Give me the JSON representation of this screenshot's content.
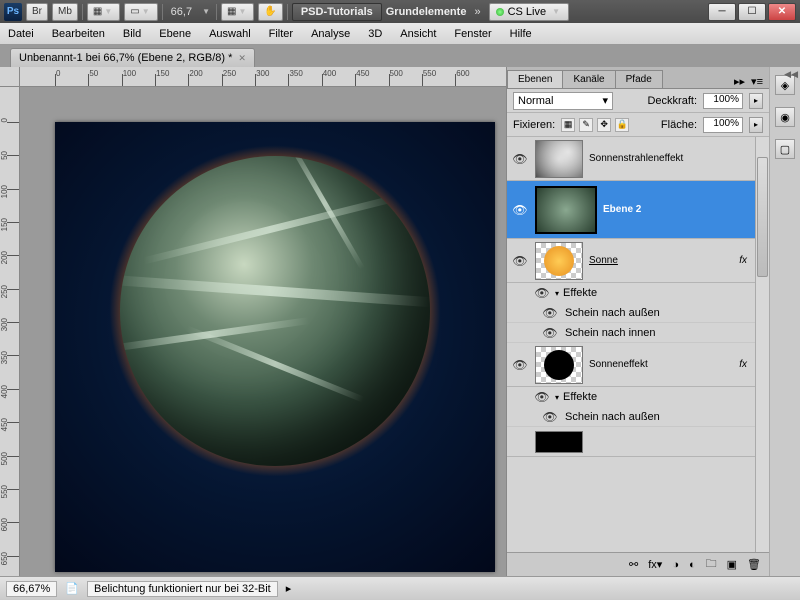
{
  "titlebar": {
    "br": "Br",
    "mb": "Mb",
    "zoom": "66,7",
    "psd_tutorials": "PSD-Tutorials",
    "grundelemente": "Grundelemente",
    "cs_live": "CS Live"
  },
  "menu": {
    "items": [
      "Datei",
      "Bearbeiten",
      "Bild",
      "Ebene",
      "Auswahl",
      "Filter",
      "Analyse",
      "3D",
      "Ansicht",
      "Fenster",
      "Hilfe"
    ]
  },
  "doc": {
    "tab": "Unbenannt-1 bei 66,7% (Ebene 2, RGB/8) *"
  },
  "panel": {
    "tabs": {
      "ebenen": "Ebenen",
      "kanaele": "Kanäle",
      "pfade": "Pfade"
    },
    "blend": {
      "mode": "Normal",
      "opacity_label": "Deckkraft:",
      "opacity": "100%",
      "fix_label": "Fixieren:",
      "fill_label": "Fläche:",
      "fill": "100%"
    },
    "layers": {
      "l1": "Sonnenstrahleneffekt",
      "l2": "Ebene 2",
      "l3": "Sonne",
      "effekte": "Effekte",
      "outer": "Schein nach außen",
      "inner": "Schein nach innen",
      "l4": "Sonneneffekt",
      "fx": "fx"
    }
  },
  "status": {
    "zoom": "66,67%",
    "msg": "Belichtung funktioniert nur bei 32-Bit"
  }
}
